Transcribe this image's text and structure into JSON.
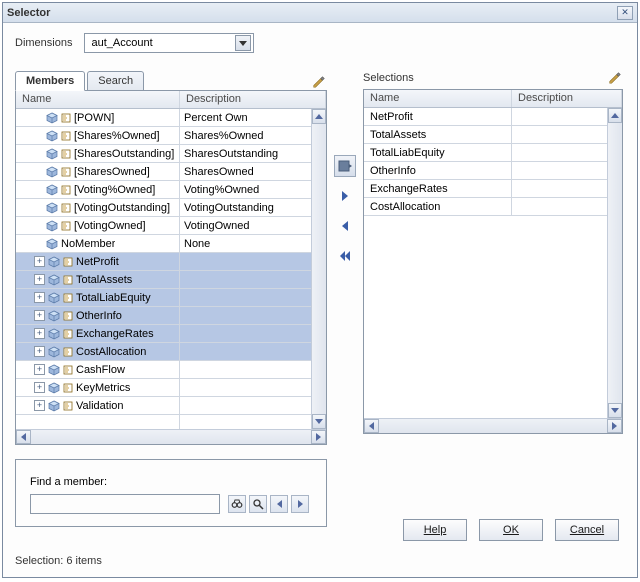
{
  "window": {
    "title": "Selector"
  },
  "dimensions": {
    "label": "Dimensions",
    "value": "aut_Account"
  },
  "tabs": {
    "members": "Members",
    "search": "Search"
  },
  "left_table": {
    "header_name": "Name",
    "header_desc": "Description",
    "rows": [
      {
        "indent": 2,
        "expander": false,
        "pick": true,
        "name": "[POWN]",
        "desc": "Percent Own",
        "selected": false
      },
      {
        "indent": 2,
        "expander": false,
        "pick": true,
        "name": "[Shares%Owned]",
        "desc": "Shares%Owned",
        "selected": false
      },
      {
        "indent": 2,
        "expander": false,
        "pick": true,
        "name": "[SharesOutstanding]",
        "desc": "SharesOutstanding",
        "selected": false
      },
      {
        "indent": 2,
        "expander": false,
        "pick": true,
        "name": "[SharesOwned]",
        "desc": "SharesOwned",
        "selected": false
      },
      {
        "indent": 2,
        "expander": false,
        "pick": true,
        "name": "[Voting%Owned]",
        "desc": "Voting%Owned",
        "selected": false
      },
      {
        "indent": 2,
        "expander": false,
        "pick": true,
        "name": "[VotingOutstanding]",
        "desc": "VotingOutstanding",
        "selected": false
      },
      {
        "indent": 2,
        "expander": false,
        "pick": true,
        "name": "[VotingOwned]",
        "desc": "VotingOwned",
        "selected": false
      },
      {
        "indent": 2,
        "expander": false,
        "pick": false,
        "name": "NoMember",
        "desc": "None",
        "selected": false
      },
      {
        "indent": 1,
        "expander": true,
        "pick": true,
        "name": "NetProfit",
        "desc": "",
        "selected": true
      },
      {
        "indent": 1,
        "expander": true,
        "pick": true,
        "name": "TotalAssets",
        "desc": "",
        "selected": true
      },
      {
        "indent": 1,
        "expander": true,
        "pick": true,
        "name": "TotalLiabEquity",
        "desc": "",
        "selected": true
      },
      {
        "indent": 1,
        "expander": true,
        "pick": true,
        "name": "OtherInfo",
        "desc": "",
        "selected": true
      },
      {
        "indent": 1,
        "expander": true,
        "pick": true,
        "name": "ExchangeRates",
        "desc": "",
        "selected": true
      },
      {
        "indent": 1,
        "expander": true,
        "pick": true,
        "name": "CostAllocation",
        "desc": "",
        "selected": true
      },
      {
        "indent": 1,
        "expander": true,
        "pick": true,
        "name": "CashFlow",
        "desc": "",
        "selected": false
      },
      {
        "indent": 1,
        "expander": true,
        "pick": true,
        "name": "KeyMetrics",
        "desc": "",
        "selected": false
      },
      {
        "indent": 1,
        "expander": true,
        "pick": true,
        "name": "Validation",
        "desc": "",
        "selected": false
      }
    ],
    "extra_empty_rows": 1
  },
  "selections_label": "Selections",
  "right_table": {
    "header_name": "Name",
    "header_desc": "Description",
    "rows": [
      {
        "name": "NetProfit",
        "desc": ""
      },
      {
        "name": "TotalAssets",
        "desc": ""
      },
      {
        "name": "TotalLiabEquity",
        "desc": ""
      },
      {
        "name": "OtherInfo",
        "desc": ""
      },
      {
        "name": "ExchangeRates",
        "desc": ""
      },
      {
        "name": "CostAllocation",
        "desc": ""
      }
    ]
  },
  "find": {
    "label": "Find a member:"
  },
  "buttons": {
    "help": "Help",
    "ok": "OK",
    "cancel": "Cancel"
  },
  "status": "Selection: 6 items"
}
